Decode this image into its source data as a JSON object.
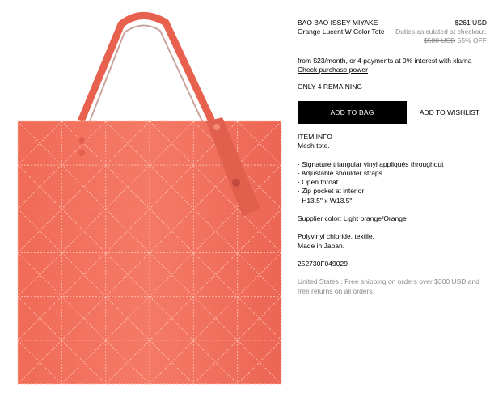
{
  "product": {
    "brand": "BAO BAO ISSEY MIYAKE",
    "name": "Orange Lucent W Color Tote",
    "price": "$261 USD",
    "duties_note": "Duties calculated at checkout.",
    "original_price": "$580 USD",
    "discount": "55% OFF"
  },
  "payments": {
    "klarna_text": "from $23/month, or 4 payments at 0% interest with klarna",
    "check_power_link": "Check purchase power"
  },
  "stock": {
    "label": "ONLY 4 REMAINING"
  },
  "actions": {
    "add_to_bag": "ADD TO BAG",
    "add_to_wishlist": "ADD TO WISHLIST"
  },
  "info": {
    "heading": "ITEM INFO",
    "summary": "Mesh tote.",
    "bullets": [
      "· Signature triangular vinyl appliqués throughout",
      "· Adjustable shoulder straps",
      "· Open throat",
      "· Zip pocket at interior",
      "· H13.5\" x W13.5\""
    ],
    "supplier_color": "Supplier color: Light orange/Orange",
    "materials": "Polyvinyl chloride, textile.",
    "origin": "Made in Japan.",
    "sku": "252730F049029"
  },
  "shipping": {
    "line1": "United States : Free shipping on orders over $300 USD and",
    "line2": "free returns on all orders."
  },
  "colors": {
    "bag": "#f3735f",
    "bag_shadow": "#d9584a",
    "seam": "#ffb8a8",
    "text_muted": "#8a8a8a"
  }
}
